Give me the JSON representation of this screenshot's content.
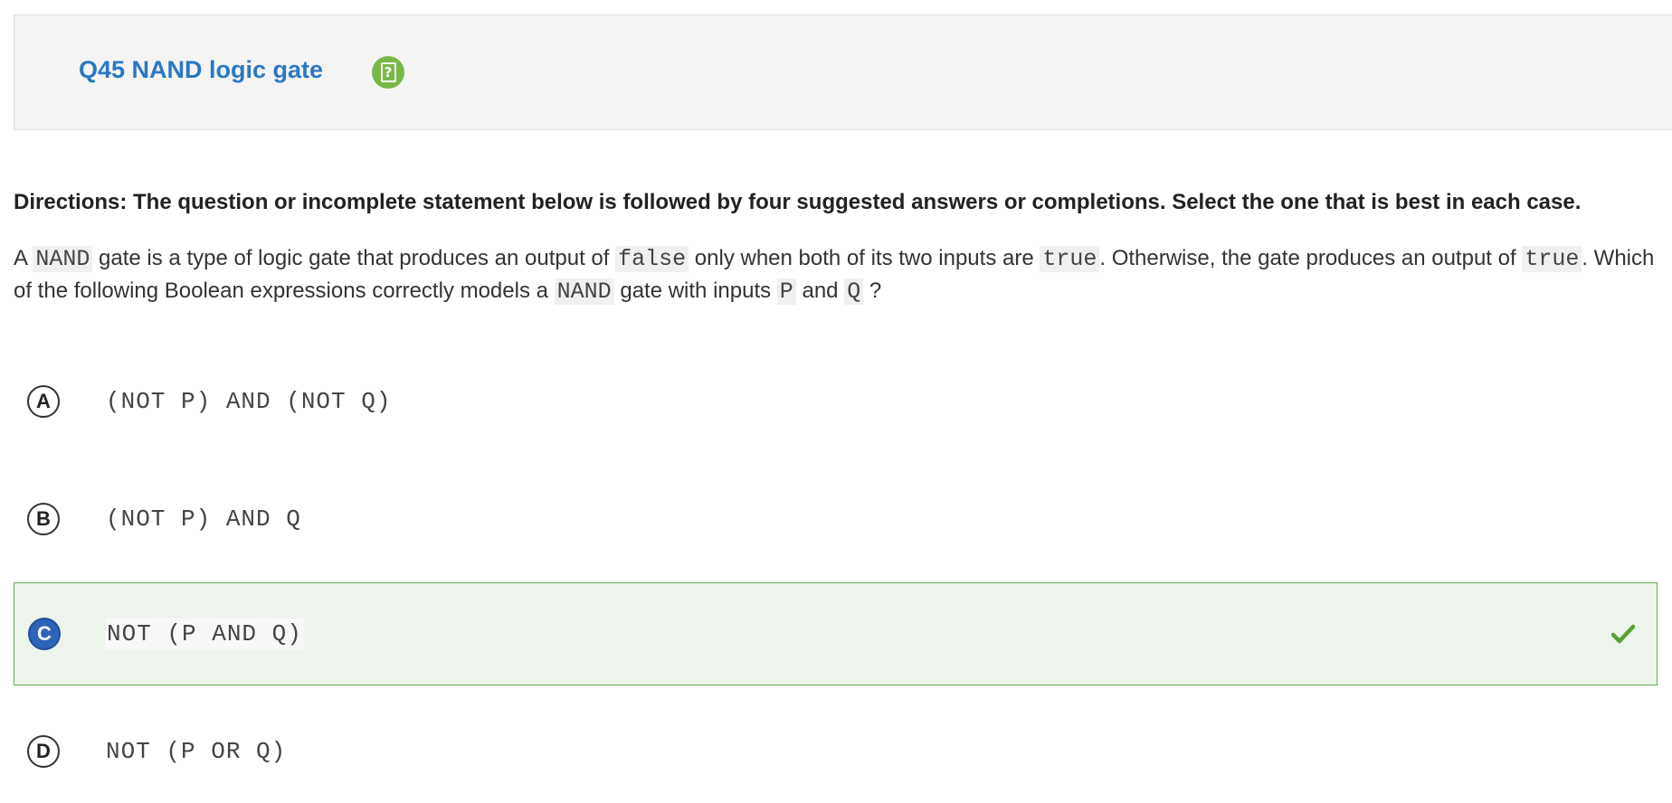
{
  "question": {
    "title": "Q45 NAND logic gate",
    "help_icon": "help-document-icon"
  },
  "directions": "Directions: The question or incomplete statement below is followed by four suggested answers or completions. Select the one that is best in each case.",
  "stem": {
    "part1": "A ",
    "code1": "NAND",
    "part2": " gate is a type of logic gate that produces an output of ",
    "code2": "false",
    "part3": " only when both of its two inputs are ",
    "code3": "true",
    "part4": ". Otherwise, the gate produces an output of ",
    "code4": "true",
    "part5": ". Which of the following Boolean expressions correctly models a ",
    "code5": "NAND",
    "part6": " gate with inputs ",
    "code6": "P",
    "part7": " and ",
    "code7": "Q",
    "part8": " ?"
  },
  "options": [
    {
      "letter": "A",
      "text": "(NOT P) AND (NOT Q)",
      "correct": false
    },
    {
      "letter": "B",
      "text": "(NOT P) AND Q",
      "correct": false
    },
    {
      "letter": "C",
      "text": "NOT (P AND Q)",
      "correct": true
    },
    {
      "letter": "D",
      "text": "NOT (P OR Q)",
      "correct": false
    }
  ],
  "colors": {
    "title": "#2b78c2",
    "help_icon": "#77b947",
    "correct_bg": "#edf4ec",
    "correct_border": "#6aa84f",
    "selected_letter": "#2e64b8",
    "check": "#5a9e3a"
  }
}
